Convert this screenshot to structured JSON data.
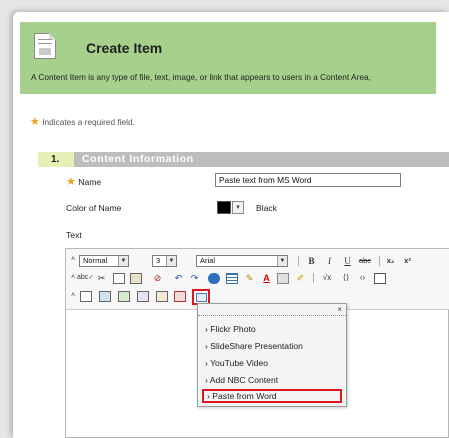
{
  "header": {
    "title": "Create Item",
    "description": "A Content Item is any type of file, text, image, or link that appears to users in a Content Area,",
    "bg_color": "#a8d08d"
  },
  "required_note": {
    "star": "★",
    "text": "Indicates a required field."
  },
  "section": {
    "number": "1.",
    "title": "Content Information"
  },
  "form": {
    "name_label": "Name",
    "name_value": "Paste text from MS Word",
    "color_label": "Color of Name",
    "color_value": "Black",
    "text_label": "Text"
  },
  "toolbar": {
    "format_value": "Normal",
    "size_value": "3",
    "font_value": "Arial",
    "bold": "B",
    "italic": "I",
    "underline": "U",
    "strike": "abc",
    "subscript": "x₂",
    "superscript": "x²",
    "spellcheck": "abc"
  },
  "mashup_menu": {
    "close": "×",
    "items": [
      {
        "label": "Flickr Photo"
      },
      {
        "label": "SlideShare Presentation"
      },
      {
        "label": "YouTube Video"
      },
      {
        "label": "Add NBC Content"
      },
      {
        "label": "Paste from Word"
      }
    ],
    "highlight_color": "#e0161b"
  }
}
